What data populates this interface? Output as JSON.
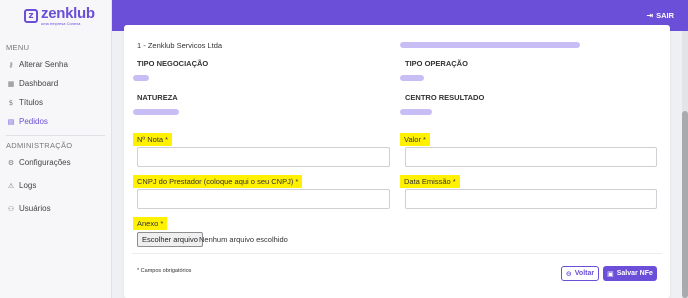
{
  "brand": {
    "name": "zenklub",
    "tagline": "uma empresa Conexa",
    "mark": "z",
    "color": "#6b4fd8"
  },
  "topbar": {
    "logout_label": "SAIR"
  },
  "sidebar": {
    "menu_title": "MENU",
    "menu_items": [
      {
        "label": "Alterar Senha",
        "icon": "key-icon"
      },
      {
        "label": "Dashboard",
        "icon": "grid-icon"
      },
      {
        "label": "Títulos",
        "icon": "dollar-icon"
      },
      {
        "label": "Pedidos",
        "icon": "document-icon",
        "active": true
      }
    ],
    "admin_title": "ADMINISTRAÇÃO",
    "admin_items": [
      {
        "label": "Configurações",
        "icon": "gear-icon"
      },
      {
        "label": "Logs",
        "icon": "warning-icon"
      },
      {
        "label": "Usuários",
        "icon": "users-icon"
      }
    ]
  },
  "form": {
    "empresa_value": "1 - Zenklub Servicos Ltda",
    "tipo_negociacao_label": "TIPO NEGOCIAÇÃO",
    "tipo_operacao_label": "TIPO OPERAÇÃO",
    "natureza_label": "NATUREZA",
    "centro_resultado_label": "CENTRO RESULTADO",
    "nota_label": "Nº Nota *",
    "valor_label": "Valor *",
    "cnpj_label": "CNPJ do Prestador (coloque aqui o seu CNPJ) *",
    "data_emissao_label": "Data Emissão *",
    "anexo_label": "Anexo *",
    "file_button_label": "Escolher arquivo",
    "file_status": "Nenhum arquivo escolhido",
    "required_note": "* Campos obrigatórios",
    "back_label": "Voltar",
    "save_label": "Salvar NFe"
  }
}
